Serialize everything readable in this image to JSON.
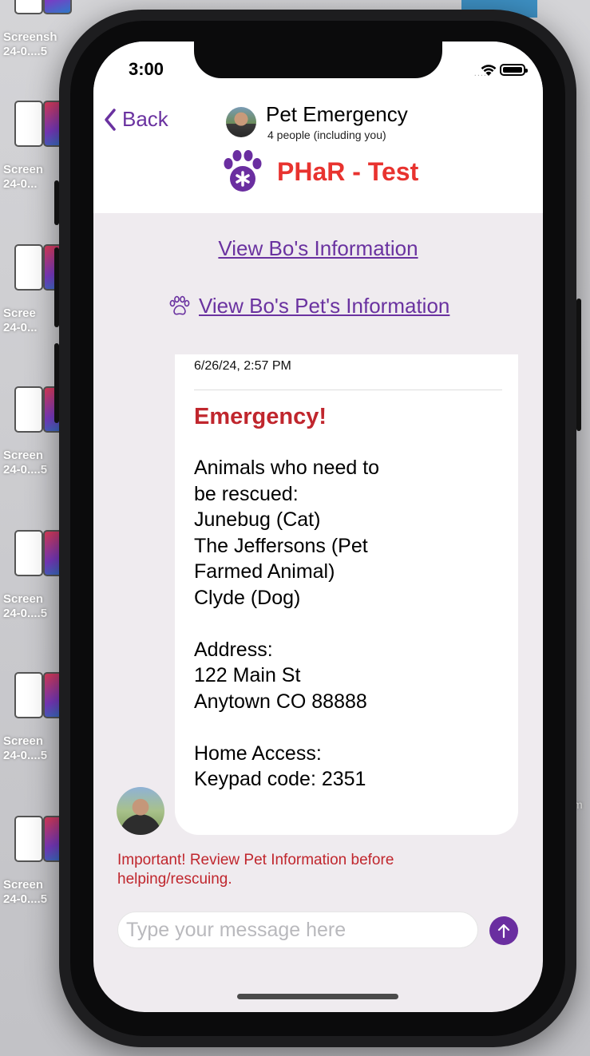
{
  "desktop": {
    "thumb_labels": [
      {
        "l1": "Screensh",
        "l2": "24-0....5"
      },
      {
        "l1": "Screen",
        "l2": "24-0..."
      },
      {
        "l1": "Scree",
        "l2": "24-0..."
      },
      {
        "l1": "Screen",
        "l2": "24-0....5"
      },
      {
        "l1": "Screen",
        "l2": "24-0....5"
      },
      {
        "l1": "Screen",
        "l2": "24-0....5"
      },
      {
        "l1": "Screen",
        "l2": "24-0....5"
      }
    ],
    "right_fragment": "m"
  },
  "status_bar": {
    "time": "3:00"
  },
  "header": {
    "back_label": "Back",
    "title": "Pet Emergency",
    "subtitle": "4 people (including you)",
    "brand_name": "PHaR - Test",
    "brand_color": "#e8332f",
    "accent_color": "#6a32a0"
  },
  "links": {
    "owner_info": "View Bo's Information",
    "pet_info": "View Bo's Pet's Information"
  },
  "message": {
    "timestamp": "6/26/24, 2:57 PM",
    "title": "Emergency!",
    "body": "Animals who need to\nbe rescued:\nJunebug (Cat)\nThe Jeffersons (Pet\nFarmed Animal)\nClyde (Dog)\n\nAddress:\n122 Main St\nAnytown CO 88888\n\nHome Access:\nKeypad code: 2351"
  },
  "warning": "Important! Review Pet Information before helping/rescuing.",
  "composer": {
    "placeholder": "Type your message here",
    "value": ""
  }
}
